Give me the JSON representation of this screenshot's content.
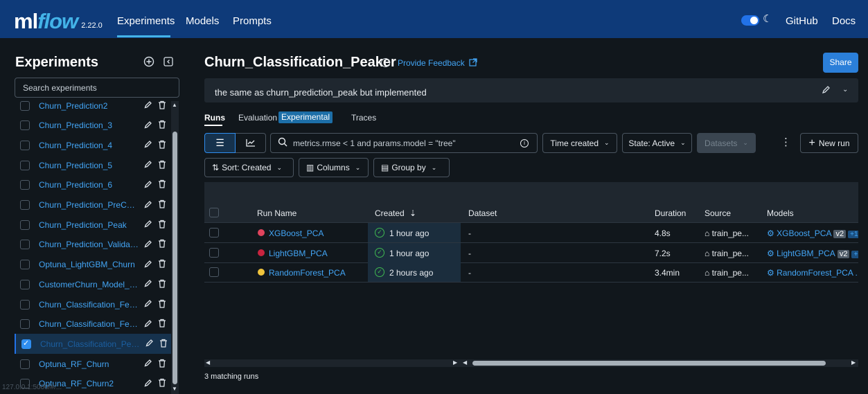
{
  "header": {
    "logo_ml": "ml",
    "logo_flow": "flow",
    "version": "2.22.0",
    "nav": [
      "Experiments",
      "Models",
      "Prompts"
    ],
    "github": "GitHub",
    "docs": "Docs"
  },
  "sidebar": {
    "title": "Experiments",
    "search_placeholder": "Search experiments",
    "items": [
      {
        "label": "Churn_Prediction2",
        "checked": false
      },
      {
        "label": "Churn_Prediction_3",
        "checked": false
      },
      {
        "label": "Churn_Prediction_4",
        "checked": false
      },
      {
        "label": "Churn_Prediction_5",
        "checked": false
      },
      {
        "label": "Churn_Prediction_6",
        "checked": false
      },
      {
        "label": "Churn_Prediction_PreCon...",
        "checked": false
      },
      {
        "label": "Churn_Prediction_Peak",
        "checked": false
      },
      {
        "label": "Churn_Prediction_Validati...",
        "checked": false
      },
      {
        "label": "Optuna_LightGBM_Churn",
        "checked": false
      },
      {
        "label": "CustomerChurn_Model_R...",
        "checked": false
      },
      {
        "label": "Churn_Classification_Feat...",
        "checked": false
      },
      {
        "label": "Churn_Classification_Feat...",
        "checked": false
      },
      {
        "label": "Churn_Classification_Peaker",
        "checked": true
      },
      {
        "label": "Optuna_RF_Churn",
        "checked": false
      },
      {
        "label": "Optuna_RF_Churn2",
        "checked": false
      }
    ],
    "status_url": "127.0.0.1:5000/#/..."
  },
  "main": {
    "title": "Churn_Classification_Peaker",
    "feedback": "Provide Feedback",
    "share": "Share",
    "description": "the same as churn_prediction_peak but implemented",
    "tabs": {
      "runs": "Runs",
      "evaluation": "Evaluation",
      "experimental": "Experimental",
      "traces": "Traces"
    },
    "filter_value": "metrics.rmse < 1 and params.model = \"tree\"",
    "time_created": "Time created",
    "state": "State: Active",
    "datasets": "Datasets",
    "new_run": "New run",
    "sort": "Sort: Created",
    "columns": "Columns",
    "group_by": "Group by",
    "table": {
      "headers": {
        "run_name": "Run Name",
        "created": "Created",
        "dataset": "Dataset",
        "duration": "Duration",
        "source": "Source",
        "models": "Models"
      },
      "rows": [
        {
          "color": "#e0445d",
          "name": "XGBoost_PCA",
          "created": "1 hour ago",
          "dataset": "-",
          "duration": "4.8s",
          "source": "train_pe...",
          "model": "XGBoost_PCA",
          "version": "v2",
          "extra": "+1"
        },
        {
          "color": "#c8243f",
          "name": "LightGBM_PCA",
          "created": "1 hour ago",
          "dataset": "-",
          "duration": "7.2s",
          "source": "train_pe...",
          "model": "LightGBM_PCA",
          "version": "v2",
          "extra": "+"
        },
        {
          "color": "#f0c43c",
          "name": "RandomForest_PCA",
          "created": "2 hours ago",
          "dataset": "-",
          "duration": "3.4min",
          "source": "train_pe...",
          "model": "RandomForest_PCA ...",
          "version": "",
          "extra": ""
        }
      ]
    },
    "matching": "3 matching runs"
  }
}
